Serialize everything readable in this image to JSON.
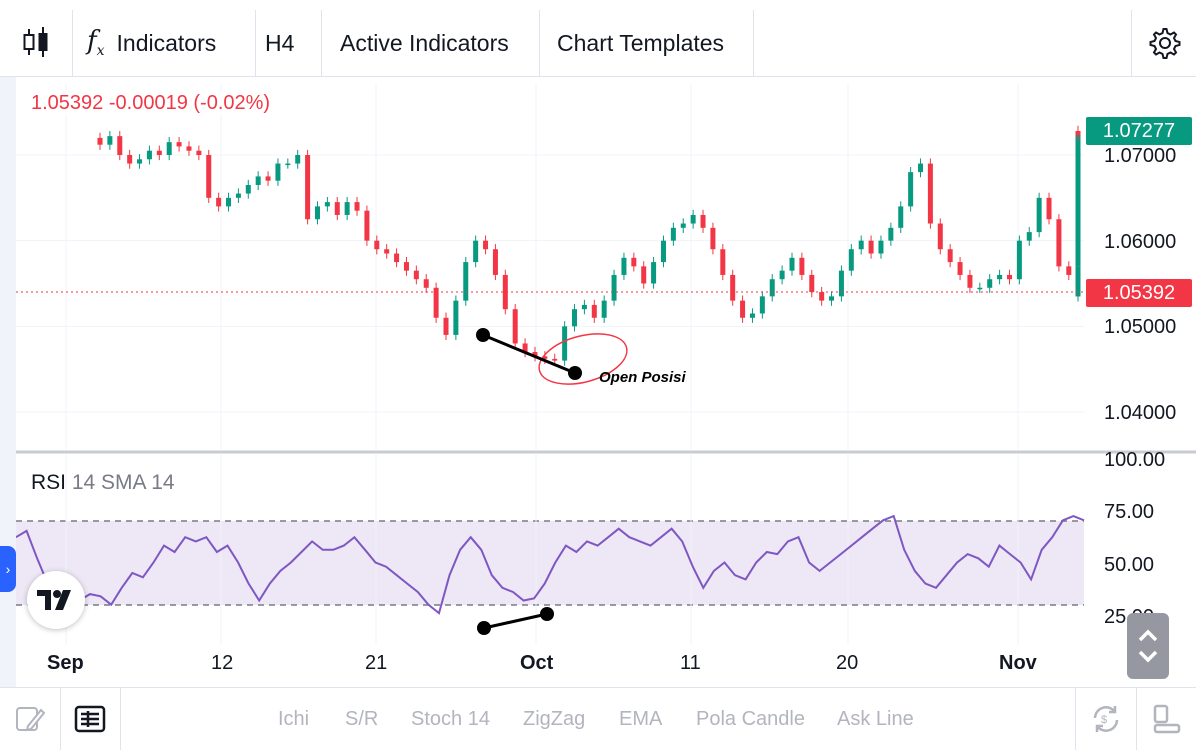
{
  "toolbar": {
    "indicators_label": "Indicators",
    "interval_label": "H4",
    "active_indicators_label": "Active Indicators",
    "chart_templates_label": "Chart Templates"
  },
  "legend": {
    "price": "1.05392",
    "change": "-0.00019",
    "change_pct": "(-0.02%)"
  },
  "price_axis": [
    "1.07000",
    "1.06000",
    "1.05000",
    "1.04000"
  ],
  "price_badges": {
    "high": "1.07277",
    "last": "1.05392",
    "high_color": "#089981",
    "last_color": "#f23645"
  },
  "rsi": {
    "name": "RSI",
    "params": "14 SMA 14",
    "axis": [
      "100.00",
      "75.00",
      "50.00",
      "25.00"
    ]
  },
  "time_axis": [
    "Sep",
    "12",
    "21",
    "Oct",
    "11",
    "20",
    "Nov"
  ],
  "annotation": "Open Posisi",
  "bottom_bar": {
    "items": [
      "Ichi",
      "S/R",
      "Stoch 14",
      "ZigZag",
      "EMA",
      "Pola Candle",
      "Ask Line"
    ]
  },
  "colors": {
    "up": "#089981",
    "down": "#f23645",
    "rsi_line": "#7e57c2",
    "rsi_band": "#ede7f6"
  },
  "chart_data": [
    {
      "type": "candlestick",
      "title": "",
      "ylim": [
        1.0375,
        1.0745
      ],
      "close_series": [
        1.0712,
        1.0722,
        1.07,
        1.069,
        1.0695,
        1.0705,
        1.07,
        1.0715,
        1.071,
        1.0705,
        1.07,
        1.065,
        1.064,
        1.065,
        1.0655,
        1.0665,
        1.0675,
        1.067,
        1.069,
        1.069,
        1.07,
        1.0625,
        1.064,
        1.0645,
        1.063,
        1.0645,
        1.0635,
        1.06,
        1.059,
        1.0585,
        1.0575,
        1.0565,
        1.0555,
        1.0545,
        1.051,
        1.049,
        1.053,
        1.0575,
        1.06,
        1.059,
        1.056,
        1.052,
        1.048,
        1.047,
        1.0465,
        1.0462,
        1.046,
        1.05,
        1.052,
        1.0525,
        1.051,
        1.053,
        1.056,
        1.058,
        1.057,
        1.055,
        1.0575,
        1.06,
        1.0615,
        1.062,
        1.063,
        1.0615,
        1.059,
        1.056,
        1.053,
        1.051,
        1.0515,
        1.0535,
        1.0555,
        1.0565,
        1.058,
        1.056,
        1.054,
        1.053,
        1.0535,
        1.0565,
        1.059,
        1.06,
        1.0585,
        1.06,
        1.0615,
        1.064,
        1.068,
        1.069,
        1.062,
        1.059,
        1.0575,
        1.056,
        1.0545,
        1.0545,
        1.0555,
        1.056,
        1.0555,
        1.06,
        1.061,
        1.065,
        1.0625,
        1.057,
        1.056,
        1.0535,
        1.057,
        1.062,
        1.0615,
        1.07,
        1.0728,
        1.0723
      ]
    },
    {
      "type": "line",
      "title": "",
      "series": [
        {
          "name": "RSI",
          "values": [
            62,
            65,
            52,
            40,
            35,
            33,
            32,
            35,
            34,
            30,
            38,
            45,
            43,
            50,
            58,
            55,
            62,
            60,
            62,
            55,
            58,
            50,
            40,
            32,
            40,
            46,
            50,
            55,
            60,
            56,
            56,
            58,
            62,
            56,
            50,
            48,
            44,
            40,
            36,
            30,
            26,
            44,
            56,
            62,
            56,
            44,
            38,
            36,
            32,
            33,
            40,
            50,
            58,
            55,
            60,
            58,
            62,
            66,
            62,
            60,
            58,
            62,
            66,
            60,
            48,
            38,
            46,
            50,
            44,
            42,
            50,
            55,
            54,
            60,
            62,
            50,
            46,
            50,
            54,
            58,
            62,
            66,
            70,
            72,
            56,
            46,
            40,
            38,
            44,
            50,
            54,
            52,
            48,
            58,
            54,
            50,
            42,
            56,
            62,
            70,
            72,
            70
          ]
        }
      ],
      "ylim": [
        0,
        100
      ],
      "bands": [
        30,
        70
      ]
    }
  ]
}
